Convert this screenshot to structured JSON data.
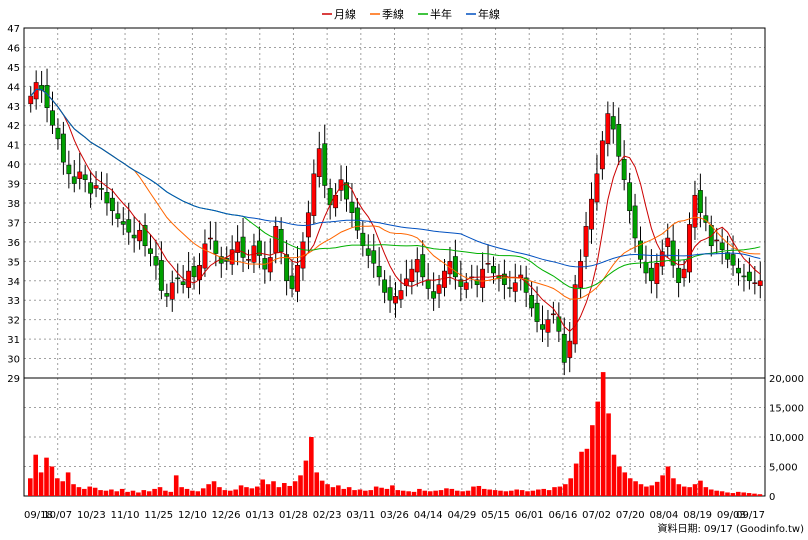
{
  "legend": [
    {
      "name": "月線",
      "color": "#cc0000"
    },
    {
      "name": "季線",
      "color": "#ff6600"
    },
    {
      "name": "半年",
      "color": "#00b000"
    },
    {
      "name": "年線",
      "color": "#0050c0"
    }
  ],
  "footer": "資料日期: 09/17  (Goodinfo.tw)",
  "chart_data": [
    {
      "type": "candlestick",
      "ylim": [
        29,
        47
      ],
      "yticks": [
        29,
        30,
        31,
        32,
        33,
        34,
        35,
        36,
        37,
        38,
        39,
        40,
        41,
        42,
        43,
        44,
        45,
        46,
        47
      ],
      "x": [
        "09/18",
        "10/07",
        "10/23",
        "11/10",
        "11/25",
        "12/10",
        "12/26",
        "01/13",
        "01/28",
        "02/23",
        "03/11",
        "03/26",
        "04/14",
        "04/29",
        "05/15",
        "06/01",
        "06/16",
        "07/02",
        "07/20",
        "08/04",
        "08/19",
        "09/03",
        "09/17"
      ],
      "ohlc_note": "approximate daily prices read from chart",
      "close": [
        43.5,
        44.2,
        43.8,
        42.9,
        42.0,
        41.3,
        40.1,
        39.5,
        39.0,
        39.6,
        39.2,
        38.5,
        38.9,
        38.7,
        38.0,
        37.6,
        37.2,
        36.9,
        36.5,
        36.2,
        36.6,
        35.8,
        35.4,
        34.8,
        33.5,
        33.2,
        33.9,
        34.1,
        33.8,
        34.5,
        34.2,
        34.8,
        35.9,
        36.2,
        35.4,
        34.9,
        35.0,
        35.6,
        36.0,
        35.2,
        35.1,
        35.8,
        35.3,
        34.6,
        35.2,
        36.8,
        35.5,
        34.0,
        33.6,
        34.8,
        36.0,
        37.5,
        39.5,
        40.8,
        38.9,
        37.9,
        38.4,
        39.2,
        38.2,
        37.5,
        36.6,
        35.8,
        35.3,
        34.9,
        34.2,
        33.4,
        33.0,
        33.2,
        33.5,
        34.1,
        34.6,
        35.1,
        34.2,
        33.6,
        33.1,
        33.8,
        34.5,
        35.0,
        34.2,
        33.7,
        33.9,
        34.2,
        33.8,
        34.6,
        34.9,
        34.4,
        34.1,
        33.8,
        33.6,
        33.9,
        34.3,
        33.4,
        32.6,
        31.9,
        31.5,
        32.0,
        32.3,
        31.4,
        29.8,
        30.9,
        33.8,
        35.0,
        36.8,
        38.2,
        39.5,
        41.2,
        42.6,
        41.8,
        40.4,
        39.2,
        37.6,
        36.2,
        35.1,
        34.4,
        34.0,
        34.9,
        35.5,
        36.2,
        34.8,
        33.9,
        34.6,
        36.9,
        38.4,
        37.5,
        37.0,
        35.8,
        36.1,
        35.6,
        35.1,
        34.8,
        34.4,
        34.2,
        34.0,
        33.9,
        34.0
      ],
      "volume_ylim": [
        0,
        20000
      ],
      "volume_yticks": [
        0,
        5000,
        10000,
        15000,
        20000
      ],
      "volume_ytick_labels": [
        "0",
        "5,000",
        "10,000",
        "15,000",
        "20,000"
      ],
      "volume": [
        3000,
        7000,
        4000,
        6500,
        5000,
        3000,
        2500,
        4000,
        2000,
        1500,
        1200,
        1600,
        1400,
        1000,
        900,
        1100,
        800,
        1200,
        700,
        900,
        600,
        1000,
        800,
        1200,
        1500,
        900,
        700,
        3500,
        1500,
        1200,
        900,
        800,
        1300,
        2000,
        2500,
        1500,
        1000,
        900,
        1100,
        1800,
        1500,
        1300,
        1600,
        2800,
        2000,
        2500,
        1500,
        2200,
        1700,
        2500,
        3500,
        6000,
        10000,
        4000,
        2600,
        2000,
        1500,
        1800,
        1200,
        1500,
        1000,
        1100,
        900,
        1000,
        1600,
        1400,
        1200,
        1800,
        1000,
        900,
        800,
        700,
        1200,
        900,
        800,
        900,
        1000,
        1300,
        1200,
        900,
        800,
        900,
        1600,
        1700,
        1200,
        1100,
        1000,
        900,
        800,
        900,
        1100,
        1000,
        800,
        900,
        1100,
        1200,
        1000,
        1500,
        1600,
        2000,
        3000,
        5500,
        7500,
        8000,
        12000,
        16000,
        21000,
        14000,
        7000,
        5000,
        4000,
        3000,
        2500,
        2000,
        1600,
        1800,
        2400,
        3500,
        5000,
        3000,
        2000,
        1600,
        1500,
        2000,
        2600,
        1500,
        1100,
        900,
        800,
        600,
        500,
        700,
        600,
        500,
        400,
        300
      ]
    }
  ]
}
